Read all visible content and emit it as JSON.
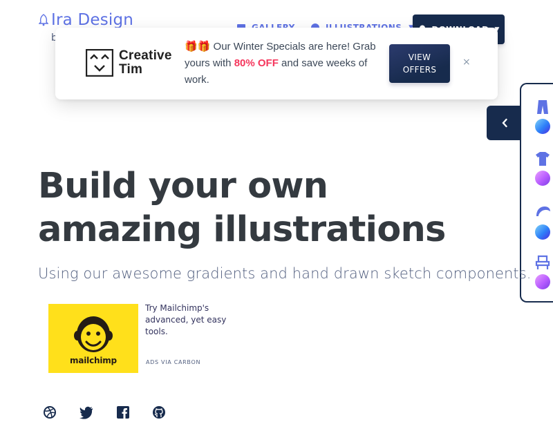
{
  "brand": {
    "name": "Ira Design",
    "sub": "b"
  },
  "nav": {
    "gallery": "GALLERY",
    "illustrations": "ILLUSTRATIONS",
    "download": "DOWNLOAD"
  },
  "promo": {
    "logo_line1": "Creative",
    "logo_line2": "Tim",
    "gifts": "🎁🎁",
    "text_a": " Our Winter Specials are here! Grab yours with ",
    "offer": "80% OFF",
    "text_b": " and save weeks of work.",
    "button_line1": "VIEW",
    "button_line2": "OFFERS",
    "close": "×"
  },
  "sidebar": {
    "items": [
      {
        "icon": "pants-icon",
        "swatch": "gradient-blue"
      },
      {
        "icon": "tshirt-icon",
        "swatch": "gradient-purple"
      },
      {
        "icon": "hair-icon",
        "swatch": "gradient-blue"
      },
      {
        "icon": "chair-icon",
        "swatch": "gradient-purple"
      }
    ]
  },
  "hero": {
    "title": "Build your own amazing illustrations",
    "subtitle": "Using our awesome gradients and hand drawn sketch components."
  },
  "ad": {
    "brand": "mailchimp",
    "text": "Try Mailchimp's advanced, yet easy tools.",
    "via": "ADS VIA CARBON"
  },
  "social": [
    "dribbble-icon",
    "twitter-icon",
    "facebook-icon",
    "github-icon"
  ],
  "colors": {
    "primary": "#5e72e4",
    "dark": "#172b4d",
    "offer_red": "#f5365c",
    "ad_yellow": "#ffe01b"
  }
}
